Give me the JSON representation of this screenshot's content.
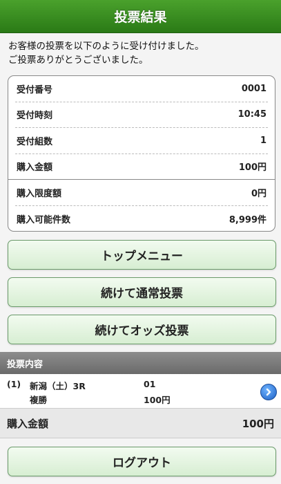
{
  "header": {
    "title": "投票結果"
  },
  "message": {
    "line1": "お客様の投票を以下のように受け付けました。",
    "line2": "ご投票ありがとうございました。"
  },
  "receipt": [
    {
      "label": "受付番号",
      "value": "0001"
    },
    {
      "label": "受付時刻",
      "value": "10:45"
    },
    {
      "label": "受付組数",
      "value": "1"
    },
    {
      "label": "購入金額",
      "value": "100円"
    },
    {
      "label": "購入限度額",
      "value": "0円"
    },
    {
      "label": "購入可能件数",
      "value": "8,999件"
    }
  ],
  "buttons": {
    "top_menu": "トップメニュー",
    "continue_normal": "続けて通常投票",
    "continue_odds": "続けてオッズ投票",
    "logout": "ログアウト"
  },
  "vote_section": {
    "title": "投票内容",
    "items": [
      {
        "index": "(1)",
        "venue": "新潟（土）3R",
        "bet_type": "複勝",
        "combination": "01",
        "amount": "100円"
      }
    ]
  },
  "total": {
    "label": "購入金額",
    "value": "100円"
  },
  "icons": {
    "vote_item_go": "chevron-right-circle-icon"
  },
  "colors": {
    "header_green": "#2a7a16",
    "button_green": "#d7eed2",
    "section_gray": "#7a7a7a",
    "go_blue": "#1d5fc4"
  }
}
